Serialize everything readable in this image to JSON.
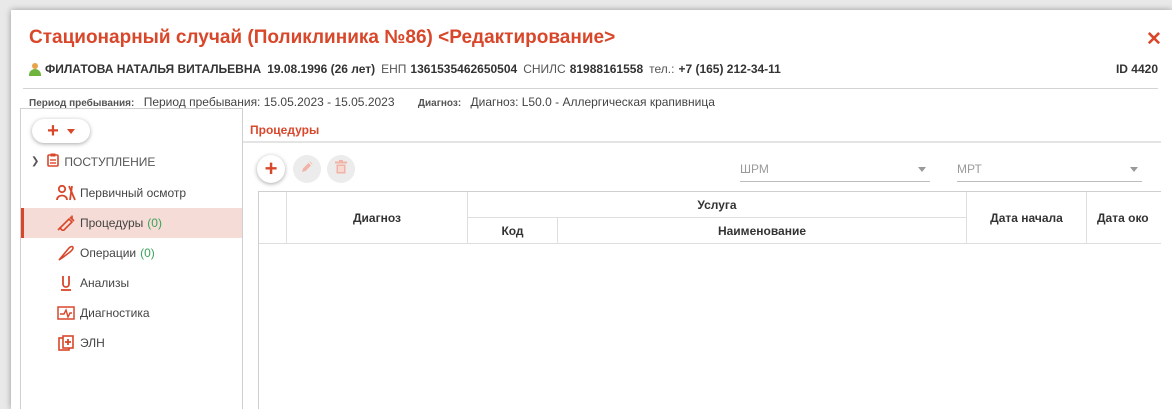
{
  "window": {
    "title": "Стационарный случай (Поликлиника №86) <Редактирование>",
    "close_icon": "close-icon"
  },
  "patient": {
    "name": "ФИЛАТОВА НАТАЛЬЯ ВИТАЛЬЕВНА",
    "birth": "19.08.1996 (26 лет)",
    "enp_label": "ЕНП",
    "enp": "1361535462650504",
    "snils_label": "СНИЛС",
    "snils": "81988161558",
    "phone_label": "тел.:",
    "phone": "+7 (165) 212-34-11",
    "id": "ID 4420",
    "avatar_icon": "person-icon"
  },
  "stay": {
    "period_label": "Период пребывания:",
    "period_value": "Период пребывания: 15.05.2023 - 15.05.2023",
    "diagnosis_label": "Диагноз:",
    "diagnosis_value": "Диагноз: L50.0 - Аллергическая крапивница"
  },
  "sidebar": {
    "add_button": "+",
    "root": {
      "label": "ПОСТУПЛЕНИЕ",
      "icon": "clipboard-icon"
    },
    "items": [
      {
        "label": "Первичный осмотр",
        "count": "",
        "icon": "doctor-icon"
      },
      {
        "label": "Процедуры",
        "count": "(0)",
        "icon": "syringe-icon"
      },
      {
        "label": "Операции",
        "count": "(0)",
        "icon": "scalpel-icon"
      },
      {
        "label": "Анализы",
        "count": "",
        "icon": "test-tube-icon"
      },
      {
        "label": "Диагностика",
        "count": "",
        "icon": "pulse-monitor-icon"
      },
      {
        "label": "ЭЛН",
        "count": "",
        "icon": "sick-leave-icon"
      }
    ]
  },
  "main": {
    "section_title": "Процедуры",
    "toolbar": {
      "add_icon": "plus-icon",
      "edit_icon": "pencil-icon",
      "delete_icon": "trash-icon"
    },
    "filters": {
      "shrm_placeholder": "ШРМ",
      "mrt_placeholder": "МРТ"
    },
    "table": {
      "col_diagnosis": "Диагноз",
      "col_service": "Услуга",
      "col_code": "Код",
      "col_name": "Наименование",
      "col_start": "Дата начала",
      "col_end": "Дата око"
    }
  },
  "colors": {
    "accent": "#d9472b",
    "active_bg": "#f6dcd6",
    "count": "#3aa35a"
  }
}
